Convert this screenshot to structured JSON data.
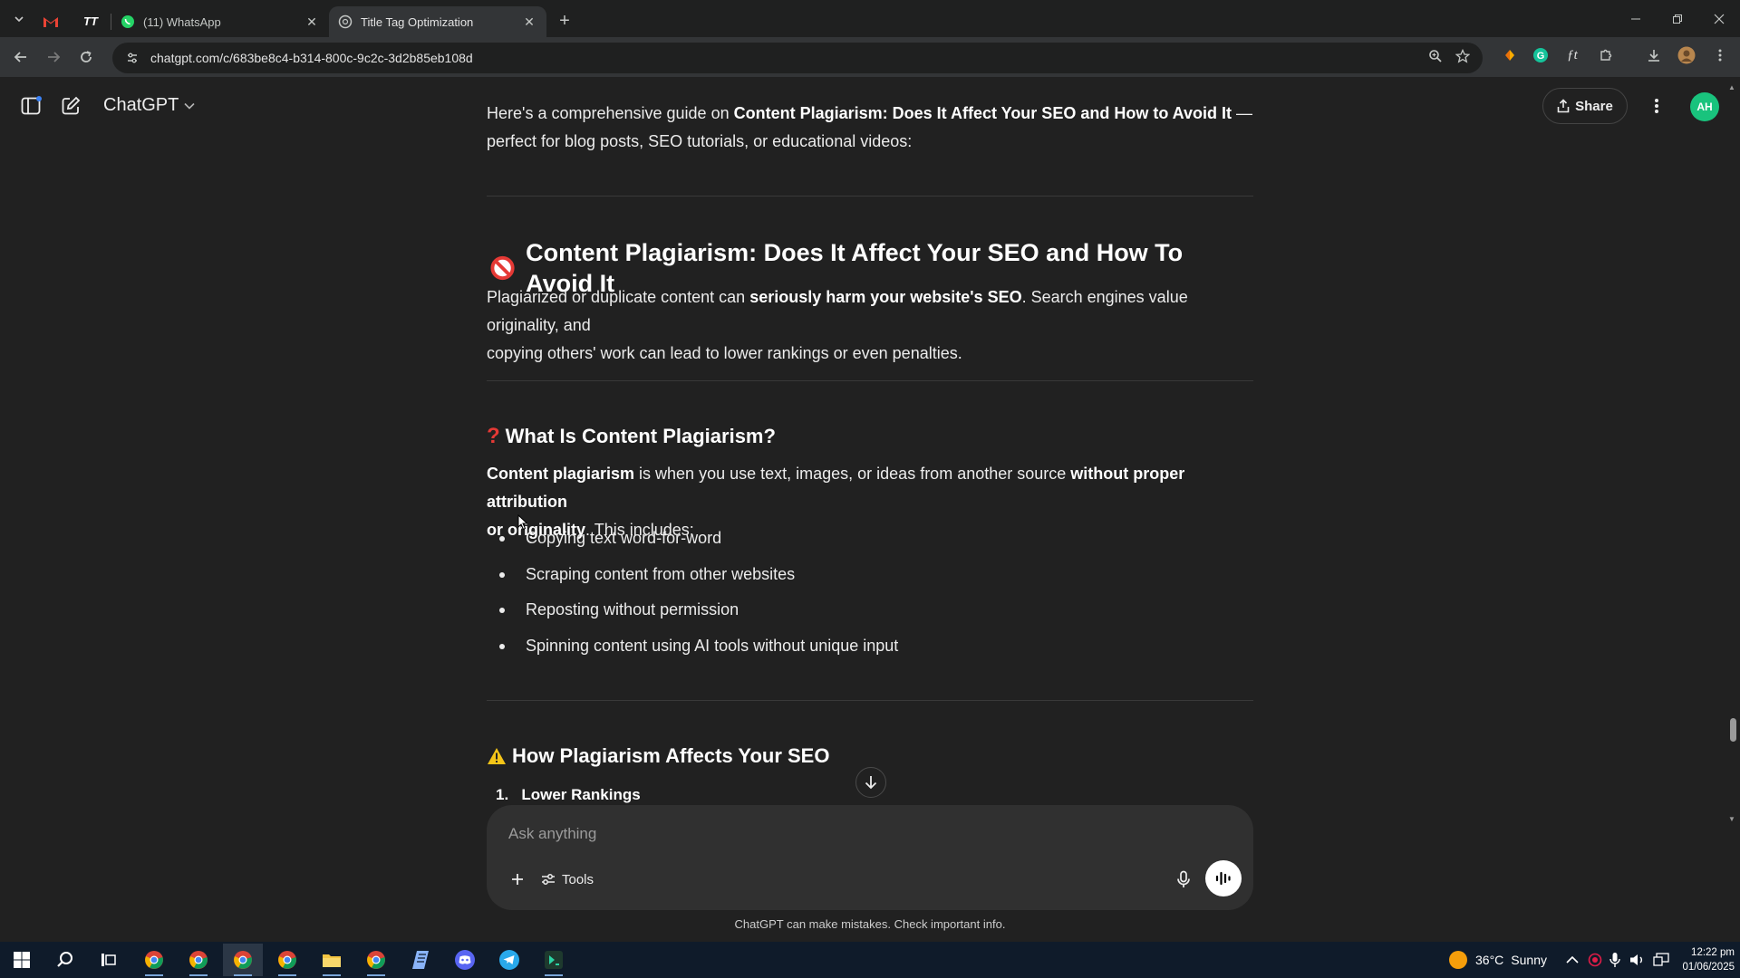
{
  "browser": {
    "tabs": [
      {
        "title": "(11) WhatsApp",
        "active": false
      },
      {
        "title": "Title Tag Optimization",
        "active": true
      }
    ],
    "url": "chatgpt.com/c/683be8c4-b314-800c-9c2c-3d2b85eb108d"
  },
  "app": {
    "name": "ChatGPT",
    "share_label": "Share",
    "avatar_initials": "AH"
  },
  "conversation": {
    "intro_line1_pre": "Here's a comprehensive guide on ",
    "intro_line1_bold": "Content Plagiarism: Does It Affect Your SEO and How to Avoid It",
    "intro_line1_post": " —",
    "intro_line2": "perfect for blog posts, SEO tutorials, or educational videos:",
    "h2_title": "Content Plagiarism: Does It Affect Your SEO and How To Avoid It",
    "p1_pre": "Plagiarized or duplicate content can ",
    "p1_bold": "seriously harm your website's SEO",
    "p1_post": ". Search engines value originality, and",
    "p1_line2": "copying others' work can lead to lower rankings or even penalties.",
    "h3_what": "What Is Content Plagiarism?",
    "def_bold1": "Content plagiarism",
    "def_mid": " is when you use text, images, or ideas from another source ",
    "def_bold2": "without proper attribution",
    "def_bold3": "or originality",
    "def_post": ". This includes:",
    "bullets": [
      "Copying text word-for-word",
      "Scraping content from other websites",
      "Reposting without permission",
      "Spinning content using AI tools without unique input"
    ],
    "h3_affects": "How Plagiarism Affects Your SEO",
    "numbered_1_num": "1.",
    "numbered_1": "Lower Rankings"
  },
  "composer": {
    "placeholder": "Ask anything",
    "tools_label": "Tools",
    "disclaimer": "ChatGPT can make mistakes. Check important info."
  },
  "taskbar": {
    "weather_temp": "36°C",
    "weather_desc": "Sunny",
    "time": "12:22 pm",
    "date": "01/06/2025"
  },
  "colors": {
    "page_bg": "#212121",
    "composer_bg": "#303030",
    "avatar_bg": "#19c37d",
    "taskbar_bg": "#0f1b2a"
  }
}
